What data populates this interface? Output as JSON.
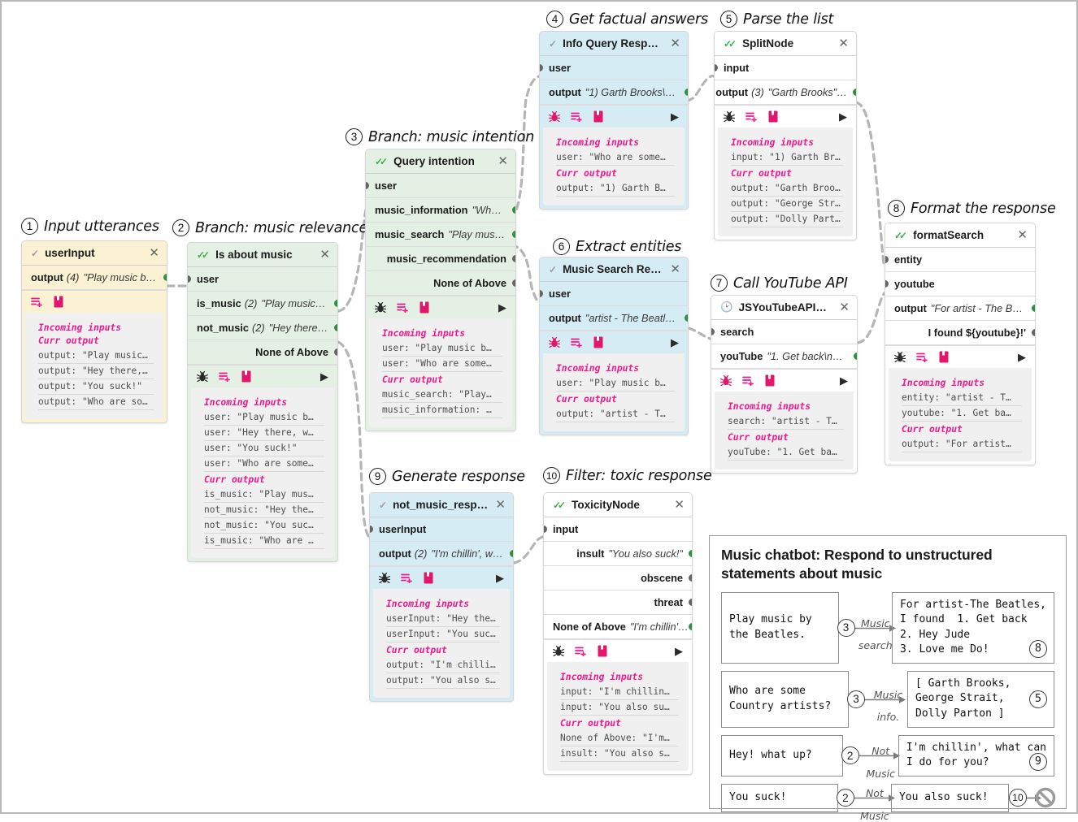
{
  "colors": {
    "accent_pink": "#f0188c",
    "port_active": "#2f8f3f",
    "port_idle": "#656565",
    "node_yellow": "#faf2d2",
    "node_green": "#e4f0e3",
    "node_blue": "#d5ecf5",
    "node_white": "#ffffff",
    "clock_orange": "#f0a202"
  },
  "callouts": [
    {
      "num": "1",
      "caption": "Input utterances"
    },
    {
      "num": "2",
      "caption": "Branch: music relevance"
    },
    {
      "num": "3",
      "caption": "Branch: music intention"
    },
    {
      "num": "4",
      "caption": "Get factual answers"
    },
    {
      "num": "5",
      "caption": "Parse the list"
    },
    {
      "num": "6",
      "caption": "Extract entities"
    },
    {
      "num": "7",
      "caption": "Call YouTube API"
    },
    {
      "num": "8",
      "caption": "Format the response"
    },
    {
      "num": "9",
      "caption": "Generate response"
    },
    {
      "num": "10",
      "caption": "Filter: toxic response"
    }
  ],
  "common": {
    "close_label": "✕",
    "play_label": "▶",
    "incoming_label": "Incoming inputs",
    "curr_output_label": "Curr output",
    "none_of_above_label": "None of Above"
  },
  "nodes": {
    "user_input": {
      "title": "userInput",
      "status_icon": "check-gray-icon",
      "rows": [
        {
          "label": "output",
          "count": "(4)",
          "value": "\"Play music by …",
          "align": "left",
          "out": "active"
        }
      ],
      "tools": [
        "list-plus-icon",
        "book-icon"
      ],
      "has_play": false,
      "has_debug": false,
      "incoming": [],
      "curr_output": [
        "output: \"Play music…",
        "output: \"Hey there,…",
        "output: \"You suck!\"",
        "output: \"Who are so…"
      ]
    },
    "is_about_music": {
      "title": "Is about music",
      "status_icon": "check-double-green-icon",
      "rows": [
        {
          "label": "user",
          "align": "left",
          "in": true
        },
        {
          "label": "is_music",
          "count": "(2)",
          "value": "\"Play music b…",
          "align": "left",
          "out": "active"
        },
        {
          "label": "not_music",
          "count": "(2)",
          "value": "\"Hey there, …",
          "align": "left",
          "out": "active"
        },
        {
          "label": "None of Above",
          "align": "right",
          "out": "idle"
        }
      ],
      "tools": [
        "bug-icon",
        "list-plus-icon",
        "book-icon"
      ],
      "has_play": true,
      "has_debug": true,
      "incoming": [
        "user: \"Play music b…",
        "user: \"Hey there, w…",
        "user: \"You suck!\"",
        "user: \"Who are some…"
      ],
      "curr_output": [
        "is_music: \"Play mus…",
        "not_music: \"Hey the…",
        "not_music: \"You suc…",
        "is_music: \"Who are …"
      ]
    },
    "query_intention": {
      "title": "Query intention",
      "status_icon": "check-double-green-icon",
      "rows": [
        {
          "label": "user",
          "align": "left",
          "in": true
        },
        {
          "label": "music_information",
          "value": "\"Who …",
          "align": "left",
          "out": "active"
        },
        {
          "label": "music_search",
          "value": "\"Play music…",
          "align": "left",
          "out": "active"
        },
        {
          "label": "music_recommendation",
          "align": "right",
          "out": "idle"
        },
        {
          "label": "None of Above",
          "align": "right",
          "out": "idle"
        }
      ],
      "tools": [
        "bug-icon",
        "list-plus-icon",
        "book-icon"
      ],
      "has_play": true,
      "has_debug": true,
      "incoming": [
        "user: \"Play music b…",
        "user: \"Who are some…"
      ],
      "curr_output": [
        "music_search: \"Play…",
        "music_information: …"
      ]
    },
    "info_query": {
      "title": "Info Query Resp…",
      "status_icon": "check-gray-icon",
      "rows": [
        {
          "label": "user",
          "align": "left",
          "in": true
        },
        {
          "label": "output",
          "value": "\"1) Garth Brooks\\n…",
          "align": "left",
          "out": "active"
        }
      ],
      "tools": [
        "bug-pink-icon",
        "list-plus-icon",
        "book-icon"
      ],
      "has_play": true,
      "has_debug": true,
      "incoming": [
        "user: \"Who are some…"
      ],
      "curr_output": [
        "output: \"1) Garth B…"
      ]
    },
    "split_node": {
      "title": "SplitNode",
      "status_icon": "check-double-green-icon",
      "rows": [
        {
          "label": "input",
          "align": "left",
          "in": true
        },
        {
          "label": "output",
          "count": "(3)",
          "value": "\"Garth Brooks\"…",
          "align": "left",
          "out": "active"
        }
      ],
      "tools": [
        "bug-icon",
        "list-plus-icon",
        "book-icon"
      ],
      "has_play": true,
      "has_debug": true,
      "incoming": [
        "input: \"1) Garth Br…"
      ],
      "curr_output": [
        "output: \"Garth Broo…",
        "output: \"George Str…",
        "output: \"Dolly Part…"
      ]
    },
    "music_search": {
      "title": "Music Search Re…",
      "status_icon": "check-gray-icon",
      "rows": [
        {
          "label": "user",
          "align": "left",
          "in": true
        },
        {
          "label": "output",
          "value": "\"artist - The Beatle…",
          "align": "left",
          "out": "active"
        }
      ],
      "tools": [
        "bug-pink-icon",
        "list-plus-icon",
        "book-icon"
      ],
      "has_play": true,
      "has_debug": true,
      "incoming": [
        "user: \"Play music b…"
      ],
      "curr_output": [
        "output: \"artist - T…"
      ]
    },
    "youtube_api": {
      "title": "JSYouTubeAPICall",
      "status_icon": "clock-orange-icon",
      "rows": [
        {
          "label": "search",
          "align": "left",
          "in": true
        },
        {
          "label": "youTube",
          "value": "\"1. Get back\\n2. …",
          "align": "left",
          "out": "active"
        }
      ],
      "tools": [
        "bug-pink-icon",
        "list-plus-icon",
        "book-icon"
      ],
      "has_play": true,
      "has_debug": true,
      "incoming": [
        "search: \"artist - T…"
      ],
      "curr_output": [
        "youTube: \"1. Get ba…"
      ]
    },
    "format_search": {
      "title": "formatSearch",
      "status_icon": "check-double-green-icon",
      "rows": [
        {
          "label": "entity",
          "align": "left",
          "in": true
        },
        {
          "label": "youtube",
          "align": "left",
          "in": true
        },
        {
          "label": "output",
          "value": "\"For artist - The B…",
          "align": "left",
          "out": "active"
        },
        {
          "label": "I found ${youtube}!'",
          "align": "right",
          "out": "idle"
        }
      ],
      "tools": [
        "bug-icon",
        "list-plus-icon",
        "book-icon"
      ],
      "has_play": true,
      "has_debug": true,
      "incoming": [
        "entity: \"artist - T…",
        "youtube: \"1. Get ba…"
      ],
      "curr_output": [
        "output: \"For artist…"
      ]
    },
    "not_music_response": {
      "title": "not_music_respo…",
      "status_icon": "check-gray-icon",
      "rows": [
        {
          "label": "userInput",
          "align": "left",
          "in": true
        },
        {
          "label": "output",
          "count": "(2)",
          "value": "\"I'm chillin', wh…",
          "align": "left",
          "out": "active"
        }
      ],
      "tools": [
        "bug-icon",
        "list-plus-icon",
        "book-icon"
      ],
      "has_play": true,
      "has_debug": true,
      "incoming": [
        "userInput: \"Hey the…",
        "userInput: \"You suc…"
      ],
      "curr_output": [
        "output: \"I'm chilli…",
        "output: \"You also s…"
      ]
    },
    "toxicity_node": {
      "title": "ToxicityNode",
      "status_icon": "check-double-green-icon",
      "rows": [
        {
          "label": "input",
          "align": "left",
          "in": true
        },
        {
          "label": "insult",
          "value": "\"You also suck!\"",
          "align": "right",
          "out": "active"
        },
        {
          "label": "obscene",
          "align": "right",
          "out": "idle"
        },
        {
          "label": "threat",
          "align": "right",
          "out": "idle"
        },
        {
          "label": "None of Above",
          "value": "\"I'm chillin'…",
          "align": "right",
          "out": "active"
        }
      ],
      "tools": [
        "bug-icon",
        "list-plus-icon",
        "book-icon"
      ],
      "has_play": true,
      "has_debug": true,
      "incoming": [
        "input: \"I'm chillin…",
        "input: \"You also su…"
      ],
      "curr_output": [
        "None of Above: \"I'm…",
        "insult: \"You also s…"
      ]
    }
  },
  "legend": {
    "title": "Music chatbot: Respond to unstructured statements about music",
    "rows": [
      {
        "input": "Play music by\nthe Beatles.",
        "step": "3",
        "branch_top": "Music",
        "branch_bottom": "search",
        "output": "For artist-The Beatles,\nI found  1. Get back\n2. Hey Jude\n3. Love me Do!",
        "out_mark": "8",
        "tail": null
      },
      {
        "input": "Who are some\nCountry artists?",
        "step": "3",
        "branch_top": "Music",
        "branch_bottom": "info.",
        "output": "[ Garth Brooks,\nGeorge Strait,\nDolly Parton ]",
        "out_mark": "5",
        "tail": null
      },
      {
        "input": "Hey! what up?",
        "step": "2",
        "branch_top": "Not",
        "branch_bottom": "Music",
        "output": "I'm chillin', what can\nI do for you?",
        "out_mark": "9",
        "tail": null
      },
      {
        "input": "You suck!",
        "step": "2",
        "branch_top": "Not",
        "branch_bottom": "Music",
        "output": "You also suck!",
        "out_mark": null,
        "tail": {
          "mark": "10",
          "icon": "blocked-icon"
        }
      }
    ]
  }
}
